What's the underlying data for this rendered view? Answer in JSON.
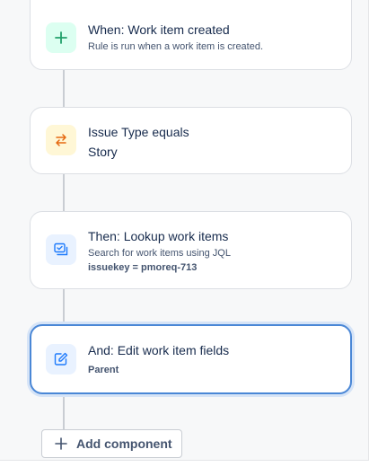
{
  "rule": {
    "trigger": {
      "title": "When: Work item created",
      "subtitle": "Rule is run when a work item is created.",
      "icon": "plus-icon",
      "color": "#22a06b"
    },
    "condition": {
      "title": "Issue Type equals",
      "value": "Story",
      "icon": "swap-arrows-icon",
      "color": "#e56910"
    },
    "lookup": {
      "title": "Then: Lookup work items",
      "subtitle": "Search for work items using JQL",
      "query": "issuekey = pmoreq-713",
      "icon": "lookup-list-icon",
      "color": "#1d7afc"
    },
    "edit": {
      "title": "And: Edit work item fields",
      "field": "Parent",
      "icon": "edit-pencil-icon",
      "color": "#1d7afc"
    }
  },
  "add_component": {
    "label": "Add component",
    "icon": "plus-icon"
  }
}
